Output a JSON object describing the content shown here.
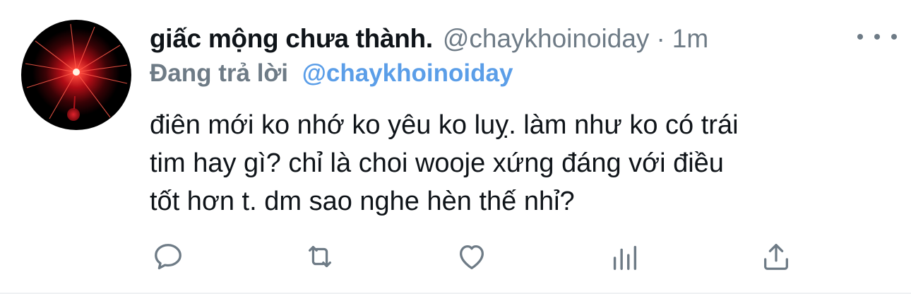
{
  "tweet": {
    "display_name": "giấc mộng chưa thành.",
    "handle": "@chaykhoinoiday",
    "separator": "·",
    "time": "1m",
    "reply_label": "Đang trả lời",
    "reply_handle": "@chaykhoinoiday",
    "body_lines": [
      "điên mới ko nhớ ko yêu ko luỵ. làm như ko có trái",
      "tim hay gì? chỉ là choi wooje xứng đáng với điều",
      "tốt hơn t. dm sao nghe hèn thế nhỉ?"
    ]
  },
  "icons": {
    "more": "more-dots-icon",
    "reply": "reply-icon",
    "retweet": "retweet-icon",
    "like": "heart-icon",
    "analytics": "analytics-icon",
    "share": "share-icon"
  },
  "colors": {
    "text": "#0f1419",
    "secondary": "#6e7b86",
    "link": "#5b9ee8",
    "avatar_bg": "#000000",
    "avatar_accent": "#d0161e"
  }
}
